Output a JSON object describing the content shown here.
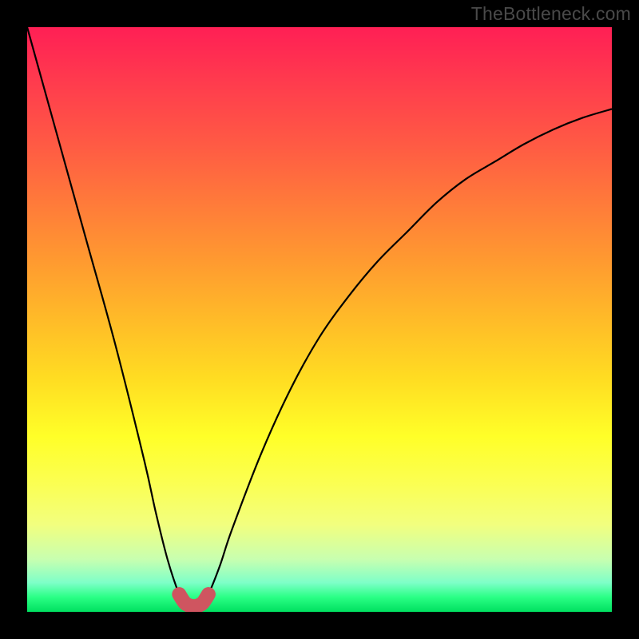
{
  "watermark": "TheBottleneck.com",
  "colors": {
    "frame": "#000000",
    "gradient_top": "#ff1f55",
    "gradient_mid": "#ffdc22",
    "gradient_bottom": "#00e060",
    "curve_stroke": "#000000",
    "highlight_stroke": "#cf5560"
  },
  "chart_data": {
    "type": "line",
    "title": "",
    "xlabel": "",
    "ylabel": "",
    "xlim": [
      0,
      100
    ],
    "ylim": [
      0,
      100
    ],
    "note": "V-shaped bottleneck curve. y values are percentages (0 = bottom/green, 100 = top/red). Minimum is highlighted near x≈26–31.",
    "series": [
      {
        "name": "bottleneck-curve",
        "x": [
          0,
          5,
          10,
          15,
          20,
          22,
          24,
          26,
          27,
          28,
          29,
          30,
          31,
          33,
          35,
          40,
          45,
          50,
          55,
          60,
          65,
          70,
          75,
          80,
          85,
          90,
          95,
          100
        ],
        "y": [
          100,
          82,
          64,
          46,
          26,
          17,
          9,
          3,
          1.5,
          1,
          1,
          1.5,
          3,
          8,
          14,
          27,
          38,
          47,
          54,
          60,
          65,
          70,
          74,
          77,
          80,
          82.5,
          84.5,
          86
        ]
      }
    ],
    "highlight": {
      "description": "trough segment drawn thick",
      "x_range": [
        25,
        32
      ],
      "color": "#cf5560",
      "thickness_px": 18
    }
  }
}
